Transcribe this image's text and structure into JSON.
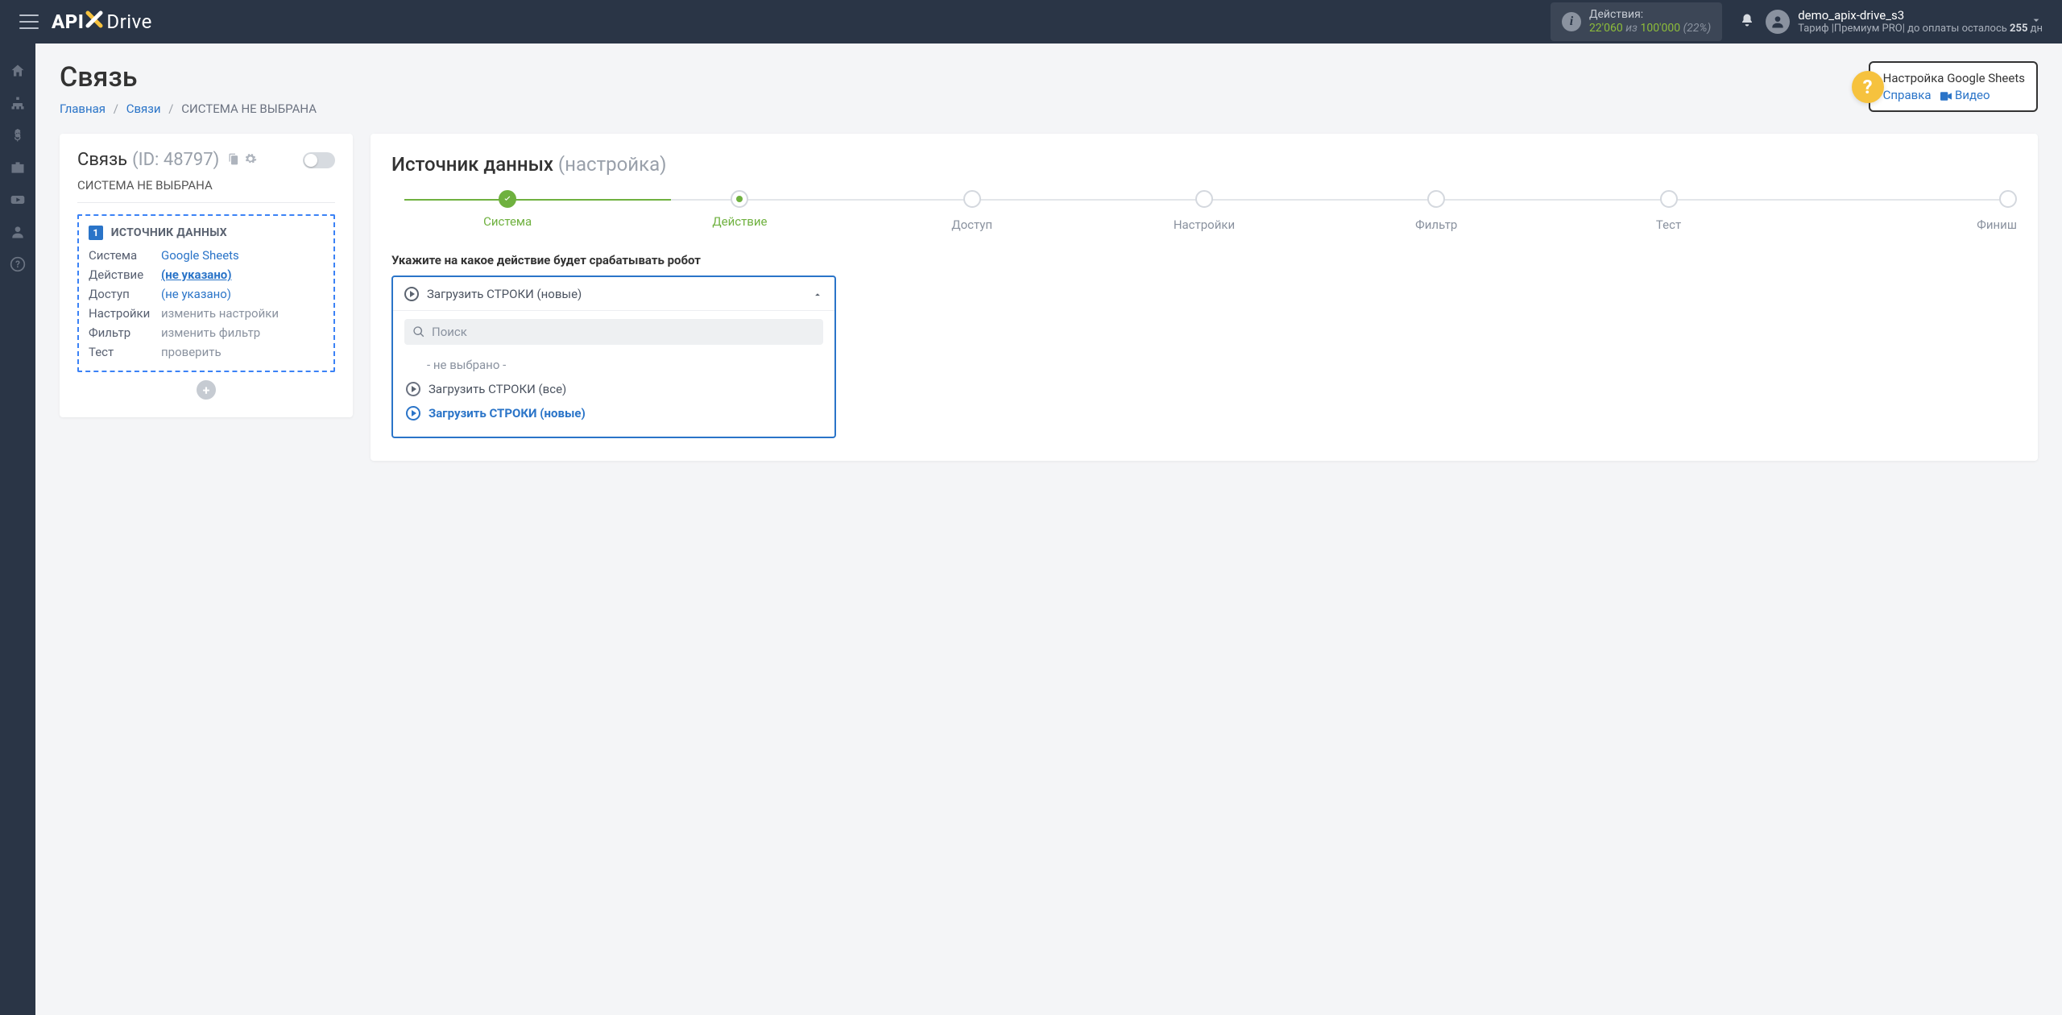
{
  "topbar": {
    "actions_label": "Действия:",
    "actions_used": "22'060",
    "actions_of": "из",
    "actions_total": "100'000",
    "actions_pct": "(22%)",
    "user_name": "demo_apix-drive_s3",
    "user_sub_prefix": "Тариф |Премиум PRO| до оплаты осталось ",
    "user_sub_days": "255",
    "user_sub_suffix": " дн"
  },
  "page": {
    "title": "Связь",
    "breadcrumb_home": "Главная",
    "breadcrumb_links": "Связи",
    "breadcrumb_current": "СИСТЕМА НЕ ВЫБРАНА"
  },
  "help": {
    "title": "Настройка Google Sheets",
    "link_ref": "Справка",
    "link_video": "Видео"
  },
  "left": {
    "title": "Связь",
    "id": "(ID: 48797)",
    "sys": "СИСТЕМА НЕ ВЫБРАНА",
    "src_badge": "1",
    "src_title": "ИСТОЧНИК ДАННЫХ",
    "rows": {
      "system_k": "Система",
      "system_v": "Google Sheets",
      "action_k": "Действие",
      "action_v": "(не указано)",
      "access_k": "Доступ",
      "access_v": "(не указано)",
      "settings_k": "Настройки",
      "settings_v": "изменить настройки",
      "filter_k": "Фильтр",
      "filter_v": "изменить фильтр",
      "test_k": "Тест",
      "test_v": "проверить"
    }
  },
  "right": {
    "title": "Источник данных",
    "title_sub": "(настройка)",
    "steps": [
      "Система",
      "Действие",
      "Доступ",
      "Настройки",
      "Фильтр",
      "Тест",
      "Финиш"
    ],
    "form_label": "Укажите на какое действие будет срабатывать робот",
    "selected": "Загрузить СТРОКИ (новые)",
    "search_placeholder": "Поиск",
    "opt_none": "- не выбрано -",
    "opt_all": "Загрузить СТРОКИ (все)",
    "opt_new": "Загрузить СТРОКИ (новые)"
  }
}
